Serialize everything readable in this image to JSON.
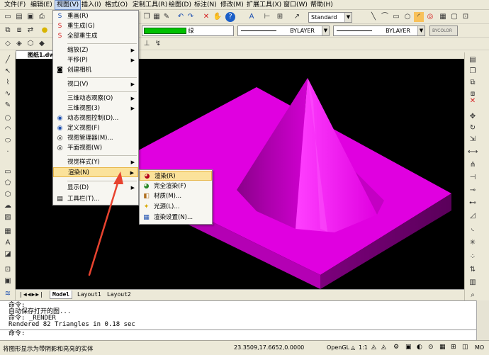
{
  "menubar": [
    "文件(F)",
    "编辑(E)",
    "视图(V)",
    "插入(I)",
    "格式(O)",
    "定制工具(R)",
    "绘图(D)",
    "标注(N)",
    "修改(M)",
    "扩展工具(X)",
    "窗口(W)",
    "帮助(H)"
  ],
  "toolbar": {
    "text_style": "Standard",
    "color_label": "绿",
    "linetype": "BYLAYER",
    "lineweight": "BYLAYER",
    "plot_style": "BYCOLOR"
  },
  "document_tab": "图纸1.dw",
  "view_menu": [
    "重画(R)",
    "重生成(G)",
    "全部重生成",
    "缩放(Z)",
    "平移(P)",
    "创建相机",
    "视口(V)",
    "三维动态观察(O)",
    "三维视图(3)",
    "动态视图控制(D)...",
    "定义视图(F)",
    "视图管理器(M)...",
    "平面视图(W)",
    "视觉样式(Y)",
    "渲染(N)",
    "显示(D)",
    "工具栏(T)..."
  ],
  "render_submenu": [
    "渲染(R)",
    "完全渲染(F)",
    "材质(M)...",
    "光源(L)...",
    "渲染设置(N)..."
  ],
  "layout_tabs": [
    "Model",
    "Layout1",
    "Layout2"
  ],
  "command_lines": [
    "命令:",
    "自动保存打开的图...",
    "命令:  _RENDER",
    "Rendered 82 Triangles in 0.18 sec",
    "命令:"
  ],
  "status": {
    "message": "将图形显示为带阴影和亮亮的实体",
    "coords": "23.3509,17.6652,0.0000",
    "renderer": "OpenGL",
    "scale": "1:1",
    "mode": "MO"
  },
  "colors": {
    "accent_highlight": "#fbe29a",
    "model_fill": "#e000e0",
    "arrow": "#e8432f",
    "color_swatch": "#00c000"
  }
}
